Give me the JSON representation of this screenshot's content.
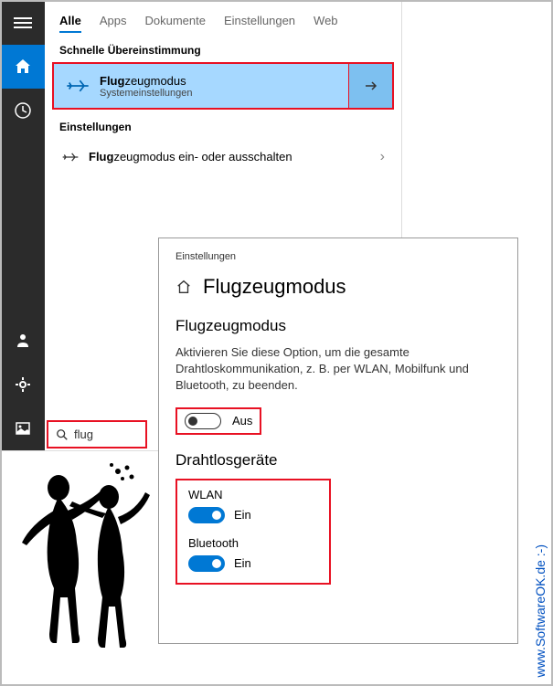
{
  "sidebar": {
    "items": [
      "menu",
      "home",
      "clock",
      "person",
      "gear",
      "image"
    ]
  },
  "tabs": [
    {
      "label": "Alle",
      "active": true
    },
    {
      "label": "Apps",
      "active": false
    },
    {
      "label": "Dokumente",
      "active": false
    },
    {
      "label": "Einstellungen",
      "active": false
    },
    {
      "label": "Web",
      "active": false
    }
  ],
  "best_match": {
    "header": "Schnelle Übereinstimmung",
    "title_prefix": "Flug",
    "title_suffix": "zeugmodus",
    "subtitle": "Systemeinstellungen"
  },
  "settings_section": {
    "header": "Einstellungen",
    "item_prefix": "Flug",
    "item_suffix": "zeugmodus ein- oder ausschalten"
  },
  "search": {
    "query": "flug"
  },
  "settings_window": {
    "label": "Einstellungen",
    "title": "Flugzeugmodus",
    "main": {
      "heading": "Flugzeugmodus",
      "description": "Aktivieren Sie diese Option, um die gesamte Drahtloskommunikation, z. B. per WLAN, Mobilfunk und Bluetooth, zu beenden.",
      "toggle_state": "Aus"
    },
    "wireless": {
      "heading": "Drahtlosgeräte",
      "devices": [
        {
          "name": "WLAN",
          "state": "Ein"
        },
        {
          "name": "Bluetooth",
          "state": "Ein"
        }
      ]
    }
  },
  "watermark": "www.SoftwareOK.de :-)"
}
